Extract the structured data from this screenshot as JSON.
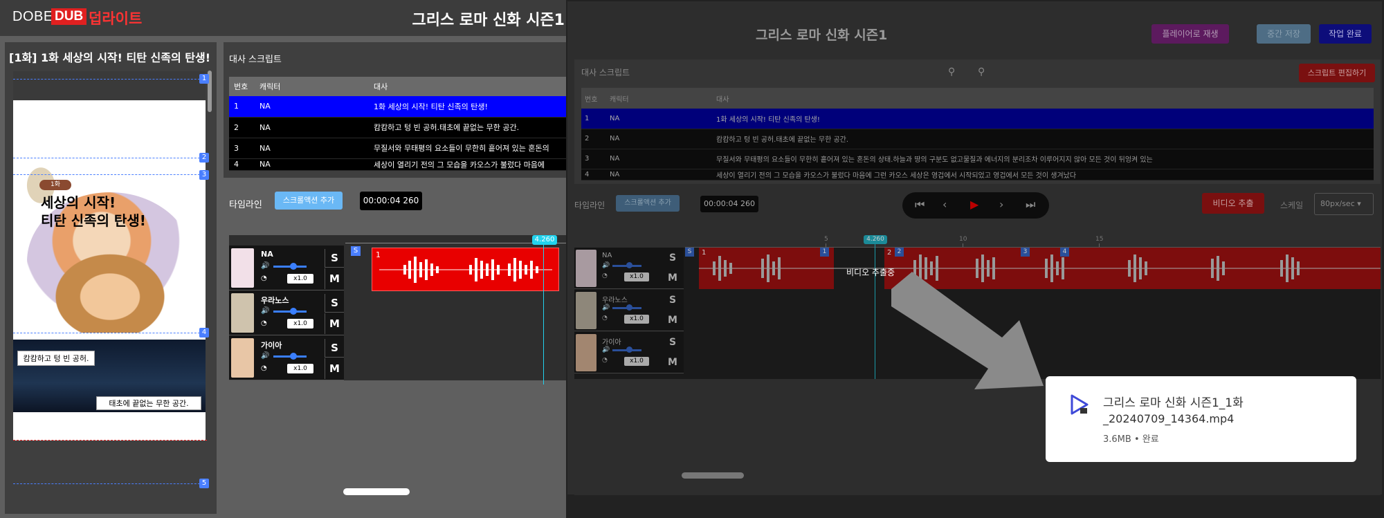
{
  "left": {
    "logo": {
      "dobe": "DOBE",
      "dub": "DUB",
      "kor": "덥라이트"
    },
    "header_title": "그리스 로마 신화 시즌1",
    "episode_title": "[1화] 1화 세상의 시작! 티탄 신족의 탄생!",
    "preview": {
      "badge": "1화",
      "caption1": "세상의 시작!",
      "caption2": "티탄 신족의 탄생!",
      "box1": "캄캄하고 텅 빈 공허.",
      "box2": "태초에 끝없는 무한 공간.",
      "markers": [
        "1",
        "2",
        "3",
        "4",
        "5"
      ]
    },
    "script": {
      "heading": "대사 스크립트",
      "columns": [
        "번호",
        "캐릭터",
        "대사"
      ],
      "rows": [
        {
          "num": "1",
          "char": "NA",
          "line": "1화 세상의 시작! 티탄 신족의 탄생!"
        },
        {
          "num": "2",
          "char": "NA",
          "line": "캄캄하고 텅 빈 공허.태초에 끝없는 무한 공간."
        },
        {
          "num": "3",
          "char": "NA",
          "line": "무질서와 무태평의 요소들이 무한히 흩어져 있는 혼돈의"
        },
        {
          "num": "4",
          "char": "NA",
          "line": "세상이 열리기 전의 그 모습을 카오스가 불렀다 마음에"
        }
      ]
    },
    "timeline": {
      "heading": "타임라인",
      "add_scroll": "스크롤액션 추가",
      "time": "00:00:04 260",
      "playhead_label": "4.260",
      "s_badge": "S",
      "clip_num": "1",
      "tracks": [
        {
          "name": "NA",
          "rate": "x1.0"
        },
        {
          "name": "우라노스",
          "rate": "x1.0"
        },
        {
          "name": "가이아",
          "rate": "x1.0"
        }
      ],
      "s_label": "S",
      "m_label": "M"
    }
  },
  "right": {
    "title": "그리스 로마 신화 시즌1",
    "play_button": "플레이어로 재생",
    "save_button": "중간 저장",
    "done_button": "작업 완료",
    "script": {
      "heading": "대사 스크립트",
      "edit_button": "스크립트 편집하기",
      "columns": [
        "번호",
        "캐릭터",
        "대사"
      ],
      "rows": [
        {
          "num": "1",
          "char": "NA",
          "line": "1화 세상의 시작! 티탄 신족의 탄생!"
        },
        {
          "num": "2",
          "char": "NA",
          "line": "캄캄하고 텅 빈 공허.태초에 끝없는 무한 공간."
        },
        {
          "num": "3",
          "char": "NA",
          "line": "무질서와 무태평의 요소들이 무한히 흩어져 있는 혼돈의 상태.하늘과 땅의 구분도 없고물질과 에너지의 분리조차 이루어지지 않아 모든 것이 뒤엉켜 있는"
        },
        {
          "num": "4",
          "char": "NA",
          "line": "세상이 열리기 전의 그 모습을 카오스가 불렀다 마음에 그런 카오스 세상은 영겁에서 시작되었고 영겁에서 모든 것이 생겨났다"
        }
      ]
    },
    "timeline": {
      "heading": "타임라인",
      "add_scroll": "스크롤액션 추가",
      "time": "00:00:04 260",
      "video_button": "비디오 추출",
      "scale_label": "스케일",
      "scale_value": "80px/sec",
      "ruler_ticks": [
        "5",
        "10",
        "15"
      ],
      "playhead_label": "4.260",
      "extracting": "비디오 추출중",
      "tracks": [
        {
          "name": "NA",
          "rate": "x1.0"
        },
        {
          "name": "우라노스",
          "rate": "x1.0"
        },
        {
          "name": "가이아",
          "rate": "x1.0"
        }
      ],
      "clip_nums": [
        "1",
        "2",
        "3",
        "4"
      ]
    },
    "download": {
      "filename_line1": "그리스 로마 신화 시즌1_1화",
      "filename_line2": "_20240709_14364.mp4",
      "meta": "3.6MB • 완료"
    }
  },
  "colors": {
    "accent_red": "#e80000",
    "selected_row": "#0000ff",
    "playhead": "#22d3ee",
    "add_button": "#6ab8f5"
  }
}
